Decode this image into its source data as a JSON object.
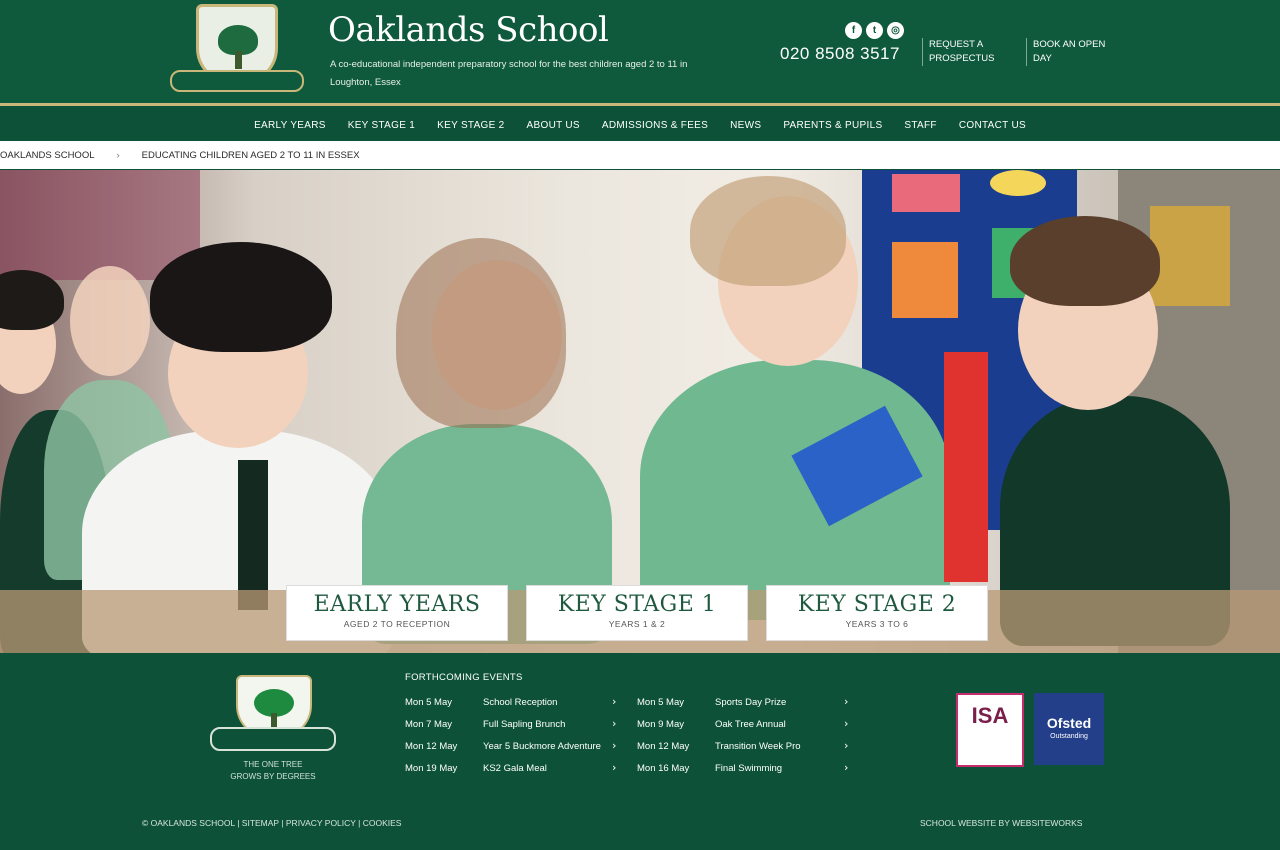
{
  "header": {
    "school_name": "Oaklands School",
    "tagline": "A co-educational independent preparatory school for the best children aged 2 to 11 in Loughton, Essex",
    "social_icons": [
      "facebook-icon",
      "twitter-icon",
      "instagram-icon"
    ],
    "phone": "020 8508 3517",
    "links": [
      "REQUEST A PROSPECTUS",
      "BOOK AN OPEN DAY"
    ]
  },
  "nav": {
    "items": [
      "EARLY YEARS",
      "KEY STAGE 1",
      "KEY STAGE 2",
      "ABOUT US",
      "ADMISSIONS & FEES",
      "NEWS",
      "PARENTS & PUPILS",
      "STAFF",
      "CONTACT US"
    ]
  },
  "breadcrumb": {
    "items": [
      "OAKLANDS SCHOOL",
      "EDUCATING CHILDREN AGED 2 TO 11 IN ESSEX"
    ],
    "separator": "›"
  },
  "hero": {
    "buttons": [
      {
        "title": "EARLY YEARS",
        "subtitle": "AGED 2 TO RECEPTION"
      },
      {
        "title": "KEY STAGE 1",
        "subtitle": "YEARS 1 & 2"
      },
      {
        "title": "KEY STAGE 2",
        "subtitle": "YEARS 3 TO 6"
      }
    ]
  },
  "footer": {
    "motto": "THE ONE TREE\nGROWS BY DEGREES",
    "events_title": "FORTHCOMING EVENTS",
    "events_left": [
      {
        "date": "Mon 5 May",
        "name": "School Reception"
      },
      {
        "date": "Mon 7 May",
        "name": "Full Sapling Brunch"
      },
      {
        "date": "Mon 12 May",
        "name": "Year 5 Buckmore Adventure"
      },
      {
        "date": "Mon 19 May",
        "name": "KS2 Gala Meal"
      }
    ],
    "events_right": [
      {
        "date": "Mon 5 May",
        "name": "Sports Day Prize"
      },
      {
        "date": "Mon 9 May",
        "name": "Oak Tree Annual"
      },
      {
        "date": "Mon 12 May",
        "name": "Transition Week Pro"
      },
      {
        "date": "Mon 16 May",
        "name": "Final Swimming"
      }
    ],
    "arrow": "›",
    "accreditations": {
      "isa": "ISA",
      "ofsted": "Ofsted",
      "ofsted_sub": "Outstanding"
    },
    "bottom_links": "© OAKLANDS SCHOOL  |  SITEMAP  |  PRIVACY POLICY  |  COOKIES",
    "credit": "SCHOOL WEBSITE BY WEBSITEWORKS"
  },
  "colors": {
    "brand_green": "#0f5a3c",
    "gold_accent": "#c9b77a",
    "white": "#ffffff"
  }
}
